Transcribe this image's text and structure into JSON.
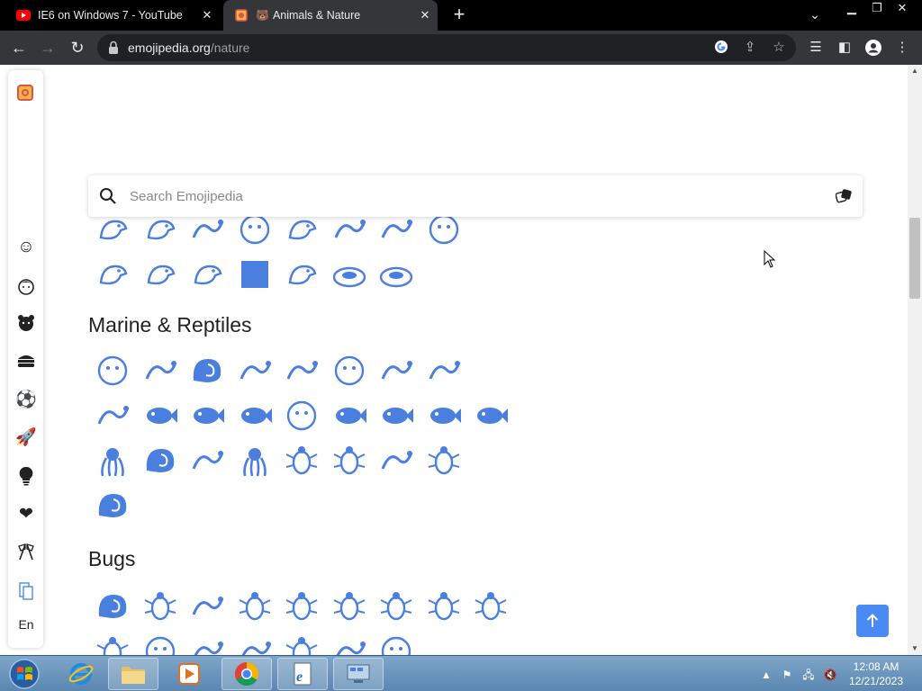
{
  "browser": {
    "tabs": [
      {
        "title": "IE6 on Windows 7 - YouTube",
        "active": false
      },
      {
        "title": "Animals & Nature",
        "active": true
      }
    ],
    "url_domain": "emojipedia.org",
    "url_path": "/nature"
  },
  "search": {
    "placeholder": "Search Emojipedia"
  },
  "sidebar": {
    "items": [
      "smileys-icon",
      "people-icon",
      "animals-icon",
      "food-icon",
      "activity-icon",
      "travel-icon",
      "objects-icon",
      "symbols-icon",
      "flags-icon",
      "clipboard-icon"
    ],
    "language": "En"
  },
  "sections": {
    "marine": {
      "title": "Marine & Reptiles"
    },
    "bugs": {
      "title": "Bugs"
    }
  },
  "colors": {
    "accent": "#4a8af4",
    "emoji_blue": "#4a7fe0"
  },
  "taskbar": {
    "time": "12:08 AM",
    "date": "12/21/2023"
  }
}
